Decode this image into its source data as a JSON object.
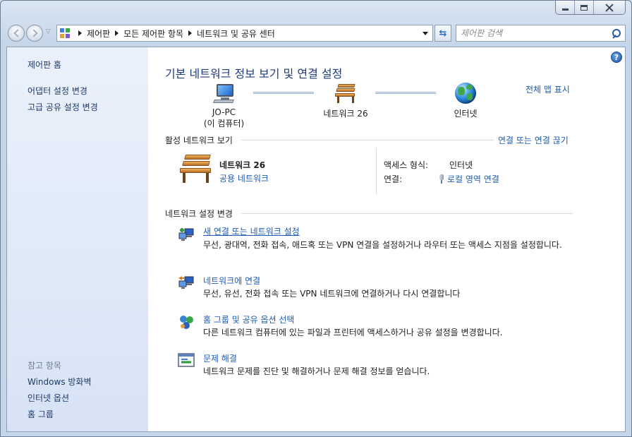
{
  "window": {
    "breadcrumbs": [
      "제어판",
      "모든 제어판 항목",
      "네트워크 및 공유 센터"
    ],
    "search_placeholder": "제어판 검색"
  },
  "sidebar": {
    "home": "제어판 홈",
    "links": [
      "어댑터 설정 변경",
      "고급 공유 설정 변경"
    ],
    "see_also_title": "참고 항목",
    "see_also": [
      "Windows 방화벽",
      "인터넷 옵션",
      "홈 그룹"
    ]
  },
  "main": {
    "title": "기본 네트워크 정보 보기 및 연결 설정",
    "full_map": "전체 맵 표시",
    "map": {
      "pc_name": "JO-PC",
      "pc_sub": "(이 컴퓨터)",
      "network": "네트워크  26",
      "internet": "인터넷"
    },
    "active": {
      "title": "활성 네트워크 보기",
      "connect_link": "연결 또는 연결 끊기",
      "network_name": "네트워크  26",
      "network_type": "공용 네트워크",
      "access_label": "액세스 형식:",
      "access_value": "인터넷",
      "conn_label": "연결:",
      "conn_value": "로컬 영역 연결"
    },
    "settings": {
      "title": "네트워크 설정 변경",
      "tasks": [
        {
          "title": "새 연결 또는 네트워크 설정",
          "desc": "무선, 광대역, 전화 접속, 애드혹 또는 VPN 연결을 설정하거나 라우터 또는 액세스 지점을 설정합니다."
        },
        {
          "title": "네트워크에 연결",
          "desc": "무선, 유선, 전화 접속 또는 VPN 네트워크에 연결하거나 다시 연결합니다"
        },
        {
          "title": "홈 그룹 및 공유 옵션 선택",
          "desc": "다른 네트워크 컴퓨터에 있는 파일과 프린터에 액세스하거나 공유 설정을 변경합니다."
        },
        {
          "title": "문제 해결",
          "desc": "네트워크 문제를 진단 및 해결하거나 문제 해결 정보를 얻습니다."
        }
      ]
    }
  }
}
